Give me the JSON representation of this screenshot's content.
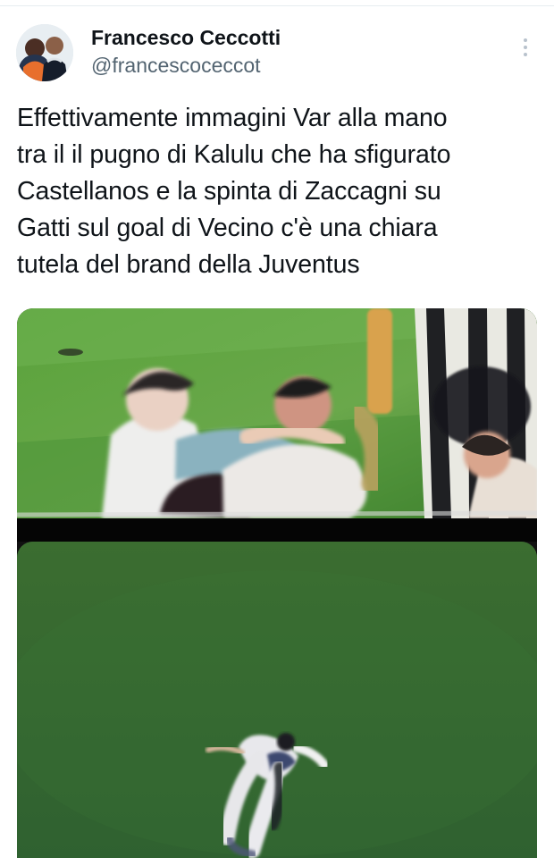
{
  "author": {
    "display_name": "Francesco Ceccotti",
    "handle": "@francescoceccot"
  },
  "tweet": {
    "text_lines": [
      "Effettivamente immagini Var alla mano",
      "tra il il pugno di Kalulu che ha sfigurato",
      "Castellanos e la spinta di Zaccagni su",
      "Gatti sul goal di Vecino c'è una chiara",
      "tutela del brand della Juventus"
    ]
  },
  "media": {
    "photos": [
      {
        "description_icon": "football-replay-image"
      },
      {
        "description_icon": "football-overhead-image"
      }
    ]
  },
  "icons": {
    "more": "vertical-ellipsis"
  },
  "colors": {
    "text": "#0f1419",
    "secondary_text": "#536471",
    "divider": "#e6ecf0"
  }
}
